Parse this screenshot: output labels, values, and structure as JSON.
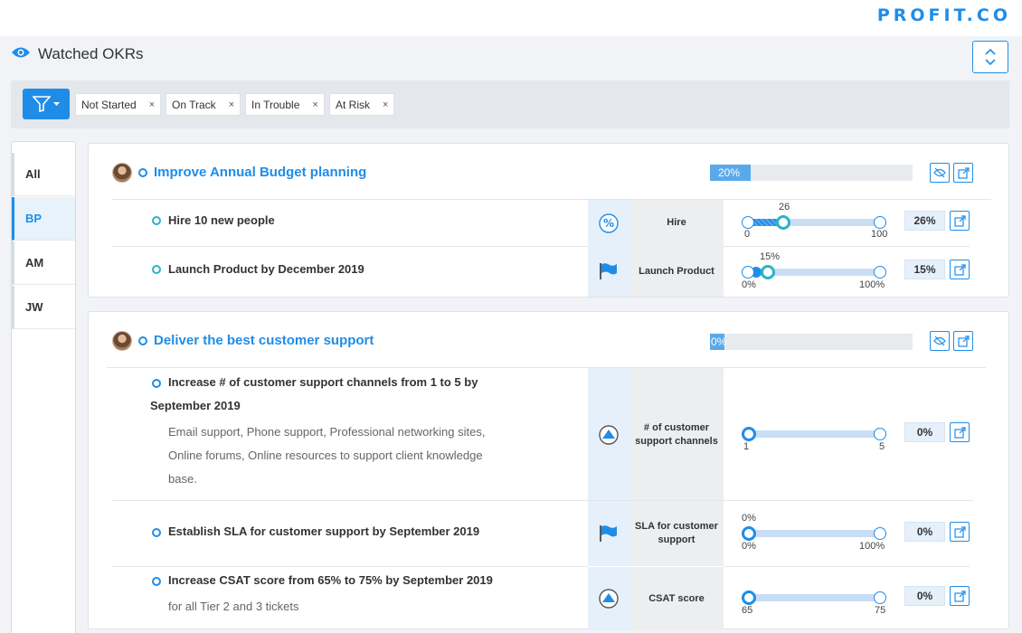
{
  "brand": {
    "name": "PROFIT.CO"
  },
  "page": {
    "title": "Watched OKRs",
    "eye_icon": "eye-icon",
    "expand_icon": "expand-collapse-icon"
  },
  "filters": {
    "button_icon": "filter-icon",
    "chips": [
      {
        "label": "Not Started",
        "remove": "×"
      },
      {
        "label": "On Track",
        "remove": "×"
      },
      {
        "label": "In Trouble",
        "remove": "×"
      },
      {
        "label": "At Risk",
        "remove": "×"
      }
    ]
  },
  "sidebar": {
    "items": [
      {
        "label": "All",
        "active": false
      },
      {
        "label": "BP",
        "active": true
      },
      {
        "label": "AM",
        "active": false
      },
      {
        "label": "JW",
        "active": false
      }
    ]
  },
  "objectives": [
    {
      "title": "Improve Annual Budget planning",
      "progress_label": "20%",
      "progress": 0.2,
      "key_results": [
        {
          "title": "Hire 10 new people",
          "type_icon": "percent-icon",
          "metric": "Hire",
          "slider": {
            "current_label": "26",
            "min_label": "0",
            "max_label": "100",
            "value": 0.26
          },
          "percent": "26%"
        },
        {
          "title": "Launch Product by December 2019",
          "type_icon": "flag-icon",
          "metric": "Launch Product",
          "slider": {
            "current_label": "15%",
            "min_label": "0%",
            "max_label": "100%",
            "value": 0.15
          },
          "percent": "15%"
        }
      ]
    },
    {
      "title": "Deliver the best customer support",
      "progress_label": "0%",
      "progress": 0,
      "key_results": [
        {
          "title_line1": "Increase # of customer support channels from 1 to 5 by",
          "title_line2": "September 2019",
          "description_lines": [
            "Email support, Phone support, Professional networking sites,",
            "Online forums, Online resources to support client knowledge",
            "base."
          ],
          "type_icon": "increase-icon",
          "metric": "# of customer support channels",
          "slider": {
            "min_label": "1",
            "max_label": "5",
            "value": 0
          },
          "percent": "0%"
        },
        {
          "title": "Establish SLA for customer support by September 2019",
          "type_icon": "flag-icon",
          "metric": "SLA for customer support",
          "slider": {
            "current_label": "0%",
            "min_label": "0%",
            "max_label": "100%",
            "value": 0
          },
          "percent": "0%"
        },
        {
          "title": "Increase CSAT score from 65% to 75% by September 2019",
          "description": "for all Tier 2 and 3 tickets",
          "type_icon": "increase-icon",
          "metric": "CSAT score",
          "slider": {
            "min_label": "65",
            "max_label": "75",
            "value": 0
          },
          "percent": "0%"
        }
      ]
    }
  ],
  "colors": {
    "accent": "#1f8de8",
    "teal": "#2cb3c6"
  }
}
